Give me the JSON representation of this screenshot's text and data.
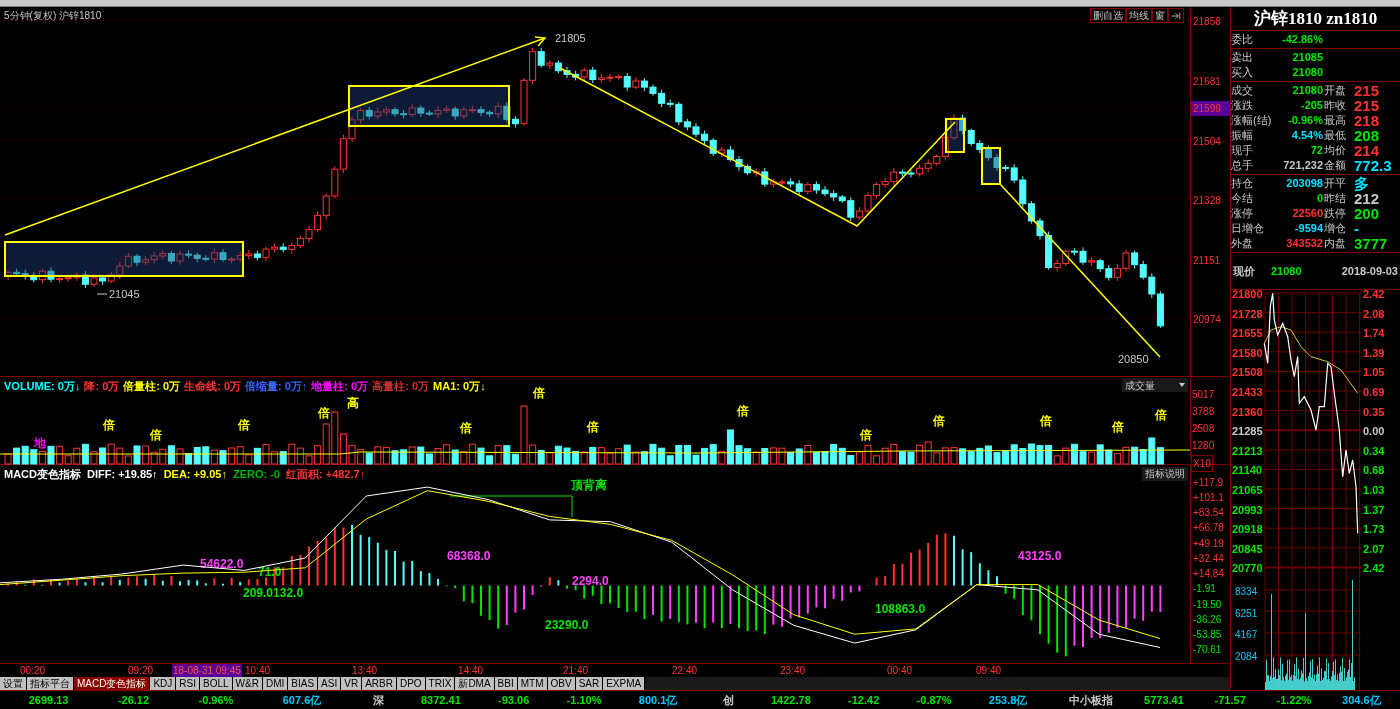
{
  "chart_header": {
    "title": "5分钟(复权) 沪锌1810",
    "buttons": [
      "删自选",
      "均线",
      "窗"
    ]
  },
  "price_axis": [
    {
      "label": "21858",
      "highlighted": false
    },
    {
      "label": "21681",
      "highlighted": false
    },
    {
      "label": "21599",
      "highlighted": true
    },
    {
      "label": "21504",
      "highlighted": false
    },
    {
      "label": "21328",
      "highlighted": false
    },
    {
      "label": "21151",
      "highlighted": false
    },
    {
      "label": "20974",
      "highlighted": false
    }
  ],
  "price_annotations": [
    "21805",
    "21045",
    "20850"
  ],
  "volume": {
    "legend": [
      {
        "label": "VOLUME:",
        "value": "0万↓",
        "color": "#00ffff"
      },
      {
        "label": "降:",
        "value": "0万",
        "color": "#ff3232"
      },
      {
        "label": "倍量柱:",
        "value": "0万",
        "color": "#ffff00"
      },
      {
        "label": "生命线:",
        "value": "0万",
        "color": "#ff3232"
      },
      {
        "label": "倍缩量:",
        "value": "0万↑",
        "color": "#3c64ff"
      },
      {
        "label": "地量柱:",
        "value": "0万",
        "color": "#ff00ff"
      },
      {
        "label": "高量柱:",
        "value": "0万",
        "color": "#c83232"
      },
      {
        "label": "MA1:",
        "value": "0万↓",
        "color": "#ffff00"
      }
    ],
    "dropdown": "成交量",
    "axis": [
      "5017",
      "3788",
      "2508",
      "1280",
      "X10"
    ],
    "markers": [
      {
        "text": "地",
        "color": "#ff00ff"
      },
      {
        "text": "倍",
        "color": "#ffff00"
      },
      {
        "text": "倍",
        "color": "#ffff00"
      },
      {
        "text": "倍",
        "color": "#ffff00"
      },
      {
        "text": "倍",
        "color": "#ffff00"
      },
      {
        "text": "高",
        "color": "#ffff00"
      },
      {
        "text": "倍",
        "color": "#ffff00"
      },
      {
        "text": "倍",
        "color": "#ffff00"
      },
      {
        "text": "倍",
        "color": "#ffff00"
      },
      {
        "text": "倍",
        "color": "#ffff00"
      },
      {
        "text": "倍",
        "color": "#ffff00"
      },
      {
        "text": "倍",
        "color": "#ffff00"
      },
      {
        "text": "倍",
        "color": "#ffff00"
      },
      {
        "text": "倍",
        "color": "#ffff00"
      },
      {
        "text": "倍",
        "color": "#ffff00"
      }
    ]
  },
  "macd": {
    "legend": [
      {
        "kind": "text",
        "text": "MACD变色指标",
        "color": "#ffffff"
      },
      {
        "kind": "series",
        "value": ": +19.85↑"
      },
      {
        "kind": "series",
        "value": ": +9.05↑"
      },
      {
        "kind": "text",
        "text": "ZERO: -0",
        "color": "#00b400"
      },
      {
        "kind": "text",
        "text": "红面积: +482.7↑",
        "color": "#ff3232"
      }
    ],
    "button": "指标说明",
    "chart_data": {
      "type": "line",
      "ylim": [
        -87.5,
        136
      ],
      "series": [
        {
          "name": "DIFF",
          "color": "#ffffff",
          "values": [
            3,
            7,
            13,
            23,
            17,
            31,
            101,
            111,
            97,
            74,
            72,
            49,
            -5,
            -45,
            -65,
            -50,
            1,
            -5,
            -55,
            -70
          ]
        },
        {
          "name": "DEA",
          "color": "#ffff00",
          "values": [
            1,
            6,
            11,
            14,
            15,
            20,
            75,
            107,
            95,
            78,
            69,
            51,
            12,
            -33,
            -55,
            -49,
            1,
            1,
            -39,
            -60
          ]
        }
      ],
      "yticks": [
        {
          "value": 117.9,
          "label": "+117.9"
        },
        {
          "value": 101.1,
          "label": "+101.1"
        },
        {
          "value": 83.54,
          "label": "+83.54"
        },
        {
          "value": 66.78,
          "label": "+66.78"
        },
        {
          "value": 49.19,
          "label": "+49.19"
        },
        {
          "value": 32.44,
          "label": "+32.44"
        },
        {
          "value": 14.84,
          "label": "+14.84"
        },
        {
          "value": -1.91,
          "label": "-1.91"
        },
        {
          "value": -19.5,
          "label": "-19.50"
        },
        {
          "value": -36.26,
          "label": "-36.26"
        },
        {
          "value": -53.85,
          "label": "-53.85"
        },
        {
          "value": -70.61,
          "label": "-70.61"
        }
      ]
    },
    "labels": [
      {
        "text": "54622.0",
        "color": "#ff40ff"
      },
      {
        "text": "71.0",
        "color": "#00e600"
      },
      {
        "text": "209.0132.0",
        "color": "#00e600"
      },
      {
        "text": "68368.0",
        "color": "#ff40ff"
      },
      {
        "text": "2294.0",
        "color": "#ff40ff"
      },
      {
        "text": "23290.0",
        "color": "#00e600"
      },
      {
        "text": "108863.0",
        "color": "#00e600"
      },
      {
        "text": "43125.0",
        "color": "#ff40ff"
      },
      {
        "text": "顶背离",
        "color": "#00e600"
      }
    ]
  },
  "time_axis": [
    {
      "label": "00:20",
      "selected": false
    },
    {
      "label": "09:20",
      "selected": false
    },
    {
      "label": "18-08-31 09:45",
      "selected": true
    },
    {
      "label": "10:40",
      "selected": false
    },
    {
      "label": "13:40",
      "selected": false
    },
    {
      "label": "14:40",
      "selected": false
    },
    {
      "label": "21:40",
      "selected": false
    },
    {
      "label": "22:40",
      "selected": false
    },
    {
      "label": "23:40",
      "selected": false
    },
    {
      "label": "00:40",
      "selected": false
    },
    {
      "label": "09:40",
      "selected": false
    }
  ],
  "indicator_tabs": [
    {
      "label": "设置",
      "selected": false
    },
    {
      "label": "指标平台",
      "selected": false
    },
    {
      "label": "MACD变色指标",
      "selected": true
    },
    {
      "label": "KDJ",
      "selected": false
    },
    {
      "label": "RSI",
      "selected": false
    },
    {
      "label": "BOLL",
      "selected": false
    },
    {
      "label": "W&R",
      "selected": false
    },
    {
      "label": "DMI",
      "selected": false
    },
    {
      "label": "BIAS",
      "selected": false
    },
    {
      "label": "ASI",
      "selected": false
    },
    {
      "label": "VR",
      "selected": false
    },
    {
      "label": "ARBR",
      "selected": false
    },
    {
      "label": "DPO",
      "selected": false
    },
    {
      "label": "TRIX",
      "selected": false
    },
    {
      "label": "新DMA",
      "selected": false
    },
    {
      "label": "BBI",
      "selected": false
    },
    {
      "label": "MTM",
      "selected": false
    },
    {
      "label": "OBV",
      "selected": false
    },
    {
      "label": "SAR",
      "selected": false
    },
    {
      "label": "EXPMA",
      "selected": false
    }
  ],
  "quote_panel": {
    "title": "沪锌1810 zn1810",
    "sections": [
      [
        {
          "cells": [
            {
              "label": "委比",
              "value": "-42.86%",
              "color": "#00e600"
            }
          ]
        }
      ],
      [
        {
          "cells": [
            {
              "label": "卖出",
              "value": "21085",
              "color": "#00e600"
            }
          ]
        },
        {
          "cells": [
            {
              "label": "买入",
              "value": "21080",
              "color": "#00e600"
            }
          ]
        }
      ],
      [
        {
          "cells": [
            {
              "label": "成交",
              "value": "21080",
              "color": "#00e600"
            },
            {
              "label": "开盘",
              "value": "215",
              "color": "#ff3232"
            }
          ]
        },
        {
          "cells": [
            {
              "label": "涨跌",
              "value": "-205",
              "color": "#00e600"
            },
            {
              "label": "昨收",
              "value": "215",
              "color": "#ff3232"
            }
          ]
        },
        {
          "cells": [
            {
              "label": "涨幅(结)",
              "value": "-0.96%",
              "color": "#00e600"
            },
            {
              "label": "最高",
              "value": "218",
              "color": "#ff3232"
            }
          ]
        },
        {
          "cells": [
            {
              "label": "振幅",
              "value": "4.54%",
              "color": "#00e0ff"
            },
            {
              "label": "最低",
              "value": "208",
              "color": "#00e600"
            }
          ]
        },
        {
          "cells": [
            {
              "label": "现手",
              "value": "72",
              "color": "#00e600"
            },
            {
              "label": "均价",
              "value": "214",
              "color": "#ff3232"
            }
          ]
        },
        {
          "cells": [
            {
              "label": "总手",
              "value": "721,232",
              "color": "#c8c8c8"
            },
            {
              "label": "金额",
              "value": "772.3",
              "color": "#00e0ff"
            }
          ]
        }
      ],
      [
        {
          "cells": [
            {
              "label": "持仓",
              "value": "203098",
              "color": "#00e0ff"
            },
            {
              "label": "开平",
              "value": "多",
              "color": "#00e0ff"
            }
          ]
        },
        {
          "cells": [
            {
              "label": "今结",
              "value": "0",
              "color": "#00e600"
            },
            {
              "label": "昨结",
              "value": "212",
              "color": "#c8c8c8"
            }
          ]
        },
        {
          "cells": [
            {
              "label": "涨停",
              "value": "22560",
              "color": "#ff3232"
            },
            {
              "label": "跌停",
              "value": "200",
              "color": "#00e600"
            }
          ]
        },
        {
          "cells": [
            {
              "label": "日增仓",
              "value": "-9594",
              "color": "#00e0ff"
            },
            {
              "label": "增仓",
              "value": "-",
              "color": "#00e0ff"
            }
          ]
        },
        {
          "cells": [
            {
              "label": "外盘",
              "value": "343532",
              "color": "#ff3232"
            },
            {
              "label": "内盘",
              "value": "3777",
              "color": "#00e600"
            }
          ]
        }
      ]
    ],
    "current": {
      "label": "现价",
      "value": "21080",
      "color": "#00e600",
      "date": "2018-09-03"
    }
  },
  "intraday": {
    "price_axis": [
      {
        "label": "21800",
        "color": "#ff3232"
      },
      {
        "label": "21728",
        "color": "#ff3232"
      },
      {
        "label": "21655",
        "color": "#ff3232"
      },
      {
        "label": "21580",
        "color": "#ff3232"
      },
      {
        "label": "21508",
        "color": "#ff3232"
      },
      {
        "label": "21433",
        "color": "#ff3232"
      },
      {
        "label": "21360",
        "color": "#ff3232"
      },
      {
        "label": "21285",
        "color": "#c8c8c8"
      },
      {
        "label": "21213",
        "color": "#00e600"
      },
      {
        "label": "21140",
        "color": "#00e600"
      },
      {
        "label": "21065",
        "color": "#00e600"
      },
      {
        "label": "20993",
        "color": "#00e600"
      },
      {
        "label": "20918",
        "color": "#00e600"
      },
      {
        "label": "20845",
        "color": "#00e600"
      },
      {
        "label": "20770",
        "color": "#00e600"
      }
    ],
    "pct_axis": [
      {
        "label": "2.42",
        "color": "#ff3232"
      },
      {
        "label": "2.08",
        "color": "#ff3232"
      },
      {
        "label": "1.74",
        "color": "#ff3232"
      },
      {
        "label": "1.39",
        "color": "#ff3232"
      },
      {
        "label": "1.05",
        "color": "#ff3232"
      },
      {
        "label": "0.69",
        "color": "#ff3232"
      },
      {
        "label": "0.35",
        "color": "#ff3232"
      },
      {
        "label": "0.00",
        "color": "#c8c8c8"
      },
      {
        "label": "0.34",
        "color": "#00e600"
      },
      {
        "label": "0.68",
        "color": "#00e600"
      },
      {
        "label": "1.03",
        "color": "#00e600"
      },
      {
        "label": "1.37",
        "color": "#00e600"
      },
      {
        "label": "1.73",
        "color": "#00e600"
      },
      {
        "label": "2.07",
        "color": "#00e600"
      },
      {
        "label": "2.42",
        "color": "#00e600"
      }
    ],
    "volume_axis": [
      "8334",
      "6251",
      "4167",
      "2084"
    ]
  },
  "status_bar": [
    {
      "values": [
        {
          "text": "2699.13",
          "color": "#00e600"
        },
        {
          "text": "-26.12",
          "color": "#00e600"
        },
        {
          "text": "-0.96%",
          "color": "#00e600"
        },
        {
          "text": "607.6亿",
          "color": "#00c8ff"
        }
      ]
    },
    {
      "label": "深",
      "values": [
        {
          "text": "8372.41",
          "color": "#00e600"
        },
        {
          "text": "-93.06",
          "color": "#00e600"
        },
        {
          "text": "-1.10%",
          "color": "#00e600"
        },
        {
          "text": "800.1亿",
          "color": "#00c8ff"
        }
      ]
    },
    {
      "label": "创",
      "values": [
        {
          "text": "1422.78",
          "color": "#00e600"
        },
        {
          "text": "-12.42",
          "color": "#00e600"
        },
        {
          "text": "-0.87%",
          "color": "#00e600"
        },
        {
          "text": "253.8亿",
          "color": "#00c8ff"
        }
      ]
    },
    {
      "label": "中小板指",
      "values": [
        {
          "text": "5773.41",
          "color": "#00e600"
        },
        {
          "text": "-71.57",
          "color": "#00e600"
        },
        {
          "text": "-1.22%",
          "color": "#00e600"
        },
        {
          "text": "304.6亿",
          "color": "#00c8ff"
        }
      ]
    }
  ]
}
